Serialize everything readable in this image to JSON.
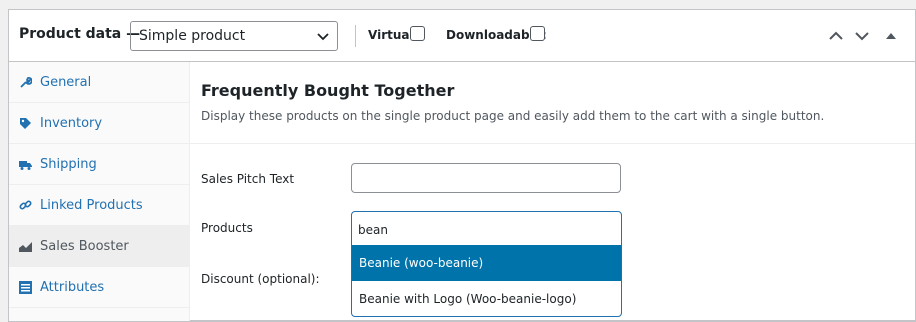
{
  "header": {
    "title": "Product data —",
    "product_type": "Simple product",
    "virtual_label": "Virtual:",
    "downloadable_label": "Downloadable:"
  },
  "sidebar": {
    "items": [
      {
        "label": "General",
        "icon": "wrench-icon"
      },
      {
        "label": "Inventory",
        "icon": "tag-icon"
      },
      {
        "label": "Shipping",
        "icon": "truck-icon"
      },
      {
        "label": "Linked Products",
        "icon": "link-icon"
      },
      {
        "label": "Sales Booster",
        "icon": "chart-icon",
        "active": true
      },
      {
        "label": "Attributes",
        "icon": "list-icon"
      }
    ]
  },
  "main": {
    "title": "Frequently Bought Together",
    "description": "Display these products on the single product page and easily add them to the cart with a single button.",
    "sales_pitch_label": "Sales Pitch Text",
    "sales_pitch_value": "",
    "products_label": "Products",
    "products_search_value": "bean",
    "discount_label": "Discount (optional):",
    "options": [
      {
        "label": "Beanie (woo-beanie)",
        "highlighted": true
      },
      {
        "label": "Beanie with Logo (Woo-beanie-logo)",
        "highlighted": false
      }
    ]
  },
  "colors": {
    "accent": "#2271b1",
    "highlight": "#0073aa"
  }
}
